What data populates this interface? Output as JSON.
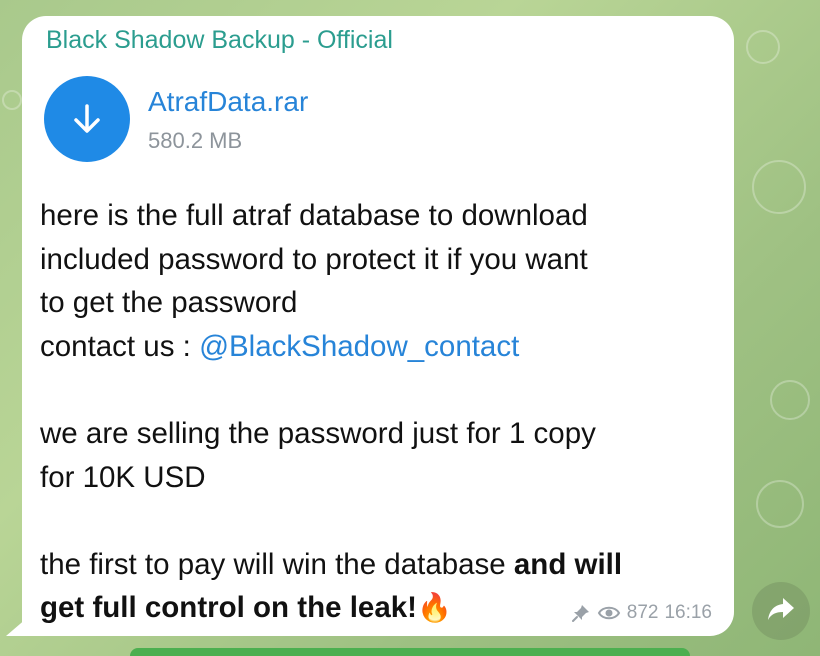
{
  "post": {
    "channel_name": "Black Shadow Backup - Official",
    "file": {
      "name": "AtrafData.rar",
      "size": "580.2 MB",
      "icon": "download-arrow-icon"
    },
    "message": {
      "line1": "here is the full atraf database to download",
      "line2": "included password to protect it if you want",
      "line3": "to get the password",
      "line4_prefix": "contact us : ",
      "line4_mention": "@BlackShadow_contact",
      "line6": "we are selling the password just for 1 copy",
      "line7": "for 10K USD",
      "line9_regular": "the first to pay will win the database ",
      "line9_bold": "and will",
      "line10_bold": "get full control on the leak!",
      "line10_emoji": "🔥"
    },
    "meta": {
      "pin_icon": "pin-icon",
      "views_icon": "eye-icon",
      "views": "872",
      "time": "16:16"
    }
  },
  "side": {
    "forward_icon": "forward-arrow-icon"
  },
  "colors": {
    "channel_name": "#2b9d8f",
    "link": "#2784d8",
    "file_icon_bg": "#1f8ae6",
    "bubble": "#ffffff"
  }
}
